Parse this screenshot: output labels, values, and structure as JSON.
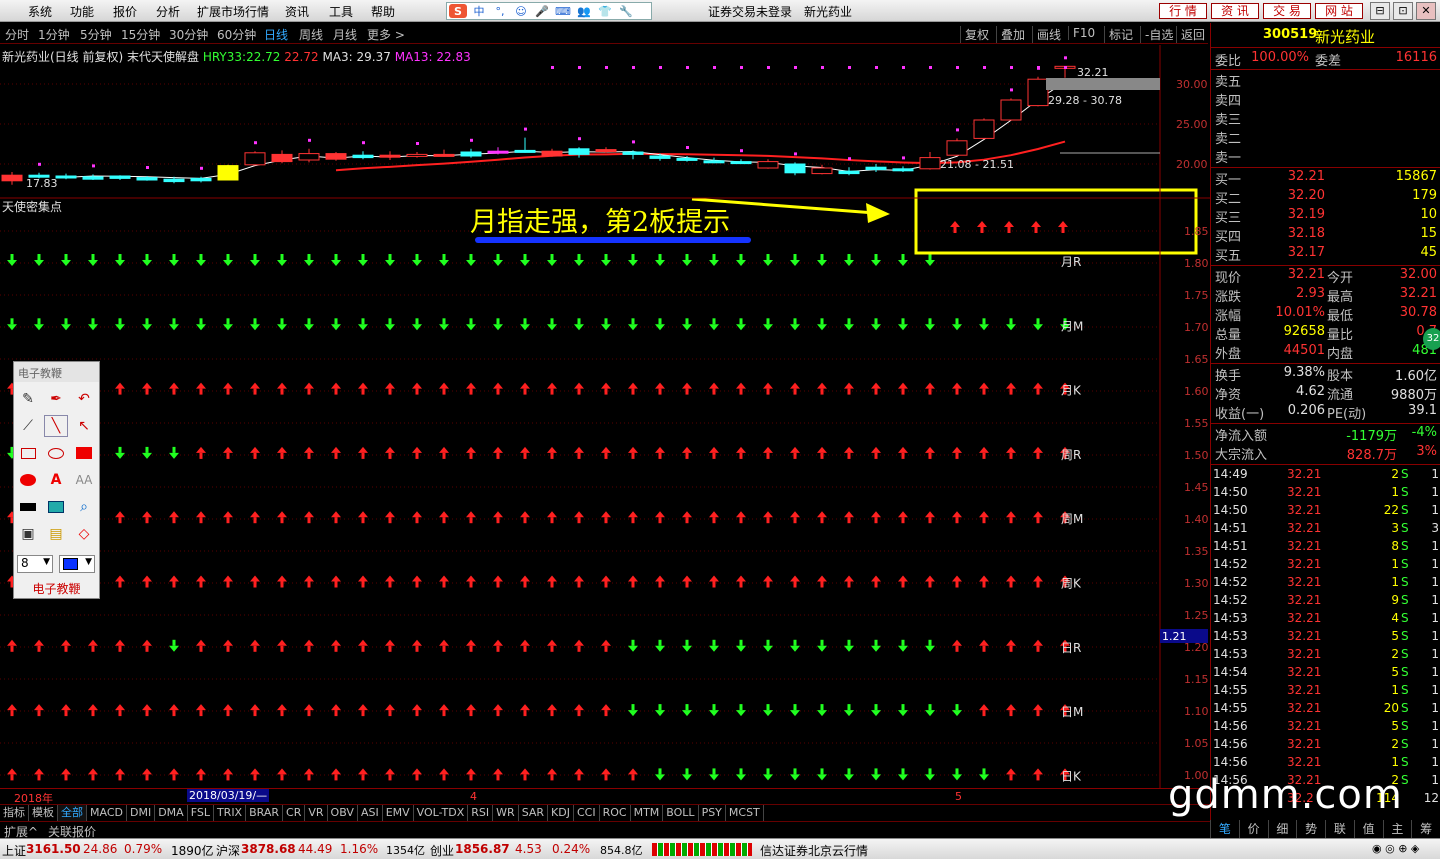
{
  "menu": [
    "系统",
    "功能",
    "报价",
    "分析",
    "扩展市场行情",
    "资讯",
    "工具",
    "帮助"
  ],
  "title": {
    "login": "证券交易未登录",
    "stock": "新光药业"
  },
  "ime_icons": [
    "S",
    "中",
    "°,",
    "☺",
    "🎤",
    "⌨",
    "👥",
    "👕",
    "🔧"
  ],
  "right_tabs": [
    "行 情",
    "资 讯",
    "交 易",
    "网 站"
  ],
  "window_buttons": [
    "⊟",
    "⊡",
    "✕"
  ],
  "periods": [
    "分时",
    "1分钟",
    "5分钟",
    "15分钟",
    "30分钟",
    "60分钟",
    "日线",
    "周线",
    "月线",
    "更多 >"
  ],
  "active_period": "日线",
  "chart_tools": [
    "复权",
    "叠加",
    "画线",
    "F10",
    "标记",
    "-自选",
    "返回"
  ],
  "infoline": {
    "name": "新光药业(日线 前复权) 末代天使解盘",
    "hry_label": "HRY33:",
    "hry_val1": "22.72",
    "hry_val2": "22.72",
    "ma3": "MA3: 29.37",
    "ma13": "MA13: 22.83"
  },
  "price_labels": {
    "high": "32.21",
    "range_upper": "29.28 - 30.78",
    "range_lower": "21.08 - 21.51",
    "low": "17.83"
  },
  "indicator_title": "天使密集点",
  "annotation": "月指走强，第2板提示",
  "upper_axis": [
    "30.00",
    "25.00",
    "20.00"
  ],
  "lower_axis": [
    "1.85",
    "1.80",
    "1.75",
    "1.70",
    "1.65",
    "1.60",
    "1.55",
    "1.50",
    "1.45",
    "1.40",
    "1.35",
    "1.30",
    "1.25",
    "1.20",
    "1.15",
    "1.10",
    "1.05",
    "1.00"
  ],
  "cursor_value": "1.21",
  "signals": [
    {
      "label": "月R",
      "pattern": "GGGGGGGGGGGGGGGGGGGGGGGGGGGGGGGGGGG"
    },
    {
      "label": "月M",
      "pattern": "GGGGGGGGGGGGGGGGGGGGGGGGGGGGGGGGGGGGGGGG"
    },
    {
      "label": "月K",
      "pattern": "RRRRRRRRRRRRRRRRRRRRRRRRRRRRRRRRRRRRRRRR"
    },
    {
      "label": "周R",
      "pattern": "GGGGGGGRRRRRRRRRRRRRRRRRRRRRRRRRRRRRRRRR"
    },
    {
      "label": "周M",
      "pattern": "RRRRRRRRRRRRRRRRRRRRRRRRRRRRRRRRRRRRRRRR"
    },
    {
      "label": "周K",
      "pattern": "RRRRRRRRRRRRRRRRRRRRRRRRRRRRRRRRRRRRRRRR"
    },
    {
      "label": "日R",
      "pattern": "RRRRRRGRRRRRRRRRRRRRRRRGGGGGGGGGGGGRRRRR"
    },
    {
      "label": "日M",
      "pattern": "RRRRRRRRRRRRRRRRRRRRRRRGGGGGGGGGGGGGRRRR"
    },
    {
      "label": "日K",
      "pattern": "RRRRRRRRRRRRRRRRRRRRRRRRGGGGGGGGGGGGGRRR"
    }
  ],
  "extra_signal_row": {
    "pattern": "RRRRR"
  },
  "date_axis": {
    "year": "2018年",
    "cursor_date": "2018/03/19/—",
    "m4": "4",
    "m5": "5"
  },
  "indicators": [
    "指标",
    "模板",
    "全部",
    "MACD",
    "DMI",
    "DMA",
    "FSL",
    "TRIX",
    "BRAR",
    "CR",
    "VR",
    "OBV",
    "ASI",
    "EMV",
    "VOL-TDX",
    "RSI",
    "WR",
    "SAR",
    "KDJ",
    "CCI",
    "ROC",
    "MTM",
    "BOLL",
    "PSY",
    "MCST"
  ],
  "active_indicator": "全部",
  "ext_bar": [
    "扩展^",
    "关联报价"
  ],
  "palette": {
    "title": "电子教鞭",
    "caption": "电子教鞭",
    "size": "8"
  },
  "quote": {
    "code": "300519",
    "name": "新光药业",
    "weibi_label": "委比",
    "weibi": "100.00%",
    "weicha_label": "委差",
    "weicha": "16116",
    "sells": [
      {
        "label": "卖五",
        "price": "",
        "vol": ""
      },
      {
        "label": "卖四",
        "price": "",
        "vol": ""
      },
      {
        "label": "卖三",
        "price": "",
        "vol": ""
      },
      {
        "label": "卖二",
        "price": "",
        "vol": ""
      },
      {
        "label": "卖一",
        "price": "",
        "vol": ""
      }
    ],
    "buys": [
      {
        "label": "买一",
        "price": "32.21",
        "vol": "15867"
      },
      {
        "label": "买二",
        "price": "32.20",
        "vol": "179"
      },
      {
        "label": "买三",
        "price": "32.19",
        "vol": "10"
      },
      {
        "label": "买四",
        "price": "32.18",
        "vol": "15"
      },
      {
        "label": "买五",
        "price": "32.17",
        "vol": "45"
      }
    ],
    "stats": [
      {
        "l1": "现价",
        "v1": "32.21",
        "l2": "今开",
        "v2": "32.00",
        "c1": "red",
        "c2": "red"
      },
      {
        "l1": "涨跌",
        "v1": "2.93",
        "l2": "最高",
        "v2": "32.21",
        "c1": "red",
        "c2": "red"
      },
      {
        "l1": "涨幅",
        "v1": "10.01%",
        "l2": "最低",
        "v2": "30.78",
        "c1": "red",
        "c2": "red"
      },
      {
        "l1": "总量",
        "v1": "92658",
        "l2": "量比",
        "v2": "0.7",
        "c1": "yel",
        "c2": "red"
      },
      {
        "l1": "外盘",
        "v1": "44501",
        "l2": "内盘",
        "v2": "481",
        "c1": "red",
        "c2": "grn"
      }
    ],
    "stats2": [
      {
        "l1": "换手",
        "v1": "9.38%",
        "l2": "股本",
        "v2": "1.60亿"
      },
      {
        "l1": "净资",
        "v1": "4.62",
        "l2": "流通",
        "v2": "9880万"
      },
      {
        "l1": "收益(一)",
        "v1": "0.206",
        "l2": "PE(动)",
        "v2": "39.1"
      }
    ],
    "flows": [
      {
        "l": "净流入额",
        "v": "-1179万",
        "p": "-4%",
        "c": "grn"
      },
      {
        "l": "大宗流入",
        "v": "828.7万",
        "p": "3%",
        "c": "red"
      }
    ],
    "badge": "32"
  },
  "ticks": [
    {
      "t": "14:49",
      "p": "32.21",
      "v": "2",
      "s": "S"
    },
    {
      "t": "14:50",
      "p": "32.21",
      "v": "1",
      "s": "S"
    },
    {
      "t": "14:50",
      "p": "32.21",
      "v": "22",
      "s": "S"
    },
    {
      "t": "14:51",
      "p": "32.21",
      "v": "3",
      "s": "S"
    },
    {
      "t": "14:51",
      "p": "32.21",
      "v": "8",
      "s": "S"
    },
    {
      "t": "14:52",
      "p": "32.21",
      "v": "1",
      "s": "S"
    },
    {
      "t": "14:52",
      "p": "32.21",
      "v": "1",
      "s": "S"
    },
    {
      "t": "14:52",
      "p": "32.21",
      "v": "9",
      "s": "S"
    },
    {
      "t": "14:53",
      "p": "32.21",
      "v": "4",
      "s": "S"
    },
    {
      "t": "14:53",
      "p": "32.21",
      "v": "5",
      "s": "S"
    },
    {
      "t": "14:53",
      "p": "32.21",
      "v": "2",
      "s": "S"
    },
    {
      "t": "14:54",
      "p": "32.21",
      "v": "5",
      "s": "S"
    },
    {
      "t": "14:55",
      "p": "32.21",
      "v": "1",
      "s": "S"
    },
    {
      "t": "14:55",
      "p": "32.21",
      "v": "20",
      "s": "S"
    },
    {
      "t": "14:56",
      "p": "32.21",
      "v": "5",
      "s": "S"
    },
    {
      "t": "14:56",
      "p": "32.21",
      "v": "2",
      "s": "S"
    },
    {
      "t": "14:56",
      "p": "32.21",
      "v": "1",
      "s": "S"
    },
    {
      "t": "14:56",
      "p": "32.21",
      "v": "2",
      "s": "S"
    }
  ],
  "tick_extra": [
    "1",
    "1",
    "1",
    "3",
    "1",
    "1",
    "1",
    "1",
    "1",
    "1",
    "1",
    "1",
    "1",
    "1",
    "1",
    "1",
    "1",
    "1"
  ],
  "tick_last": {
    "p": "32.2",
    "v": "114",
    "x": "12"
  },
  "rtabs": [
    "笔",
    "价",
    "细",
    "势",
    "联",
    "值",
    "主",
    "筹"
  ],
  "status": {
    "sh_label": "上证",
    "sh": "3161.50",
    "sh_chg": "24.86",
    "sh_pct": "0.79%",
    "sh_amt": "1890亿",
    "sz_label": "沪深",
    "sz": "3878.68",
    "sz_chg": "44.49",
    "sz_pct": "1.16%",
    "sz_amt": "1354亿",
    "cy_label": "创业",
    "cy": "1856.87",
    "cy_chg": "4.53",
    "cy_pct": "0.24%",
    "cy_amt": "854.8亿",
    "server": "信达证券北京云行情"
  },
  "watermark": "gdmm.com",
  "candles": [
    {
      "o": 18.6,
      "c": 17.9,
      "h": 19.0,
      "l": 17.4
    },
    {
      "o": 18.4,
      "c": 18.6,
      "h": 18.9,
      "l": 18.2
    },
    {
      "o": 18.3,
      "c": 18.5,
      "h": 18.8,
      "l": 18.1
    },
    {
      "o": 18.1,
      "c": 18.4,
      "h": 18.7,
      "l": 18.0
    },
    {
      "o": 18.2,
      "c": 18.5,
      "h": 18.6,
      "l": 18.0
    },
    {
      "o": 18.0,
      "c": 18.3,
      "h": 18.5,
      "l": 17.9
    },
    {
      "o": 17.8,
      "c": 18.1,
      "h": 18.4,
      "l": 17.6
    },
    {
      "o": 17.9,
      "c": 18.2,
      "h": 18.4,
      "l": 17.7
    },
    {
      "o": 18.0,
      "c": 19.8,
      "h": 19.9,
      "l": 18.0
    },
    {
      "o": 19.9,
      "c": 21.4,
      "h": 21.6,
      "l": 19.8
    },
    {
      "o": 21.2,
      "c": 20.3,
      "h": 21.7,
      "l": 20.1
    },
    {
      "o": 20.5,
      "c": 21.3,
      "h": 21.9,
      "l": 20.2
    },
    {
      "o": 21.3,
      "c": 20.6,
      "h": 21.5,
      "l": 20.4
    },
    {
      "o": 20.8,
      "c": 21.1,
      "h": 21.6,
      "l": 20.6
    },
    {
      "o": 21.1,
      "c": 20.9,
      "h": 21.6,
      "l": 20.5
    },
    {
      "o": 21.0,
      "c": 21.2,
      "h": 21.5,
      "l": 20.8
    },
    {
      "o": 21.2,
      "c": 21.0,
      "h": 21.8,
      "l": 20.9
    },
    {
      "o": 21.0,
      "c": 21.5,
      "h": 21.9,
      "l": 20.8
    },
    {
      "o": 21.4,
      "c": 21.6,
      "h": 22.1,
      "l": 21.2
    },
    {
      "o": 21.6,
      "c": 21.7,
      "h": 23.3,
      "l": 21.4
    },
    {
      "o": 21.6,
      "c": 21.0,
      "h": 21.9,
      "l": 20.9
    },
    {
      "o": 21.2,
      "c": 21.9,
      "h": 22.1,
      "l": 20.8
    },
    {
      "o": 21.8,
      "c": 21.6,
      "h": 22.1,
      "l": 21.4
    },
    {
      "o": 21.5,
      "c": 21.2,
      "h": 21.7,
      "l": 20.6
    },
    {
      "o": 21.0,
      "c": 20.7,
      "h": 21.3,
      "l": 20.4
    },
    {
      "o": 20.7,
      "c": 20.5,
      "h": 21.0,
      "l": 20.3
    },
    {
      "o": 20.4,
      "c": 20.2,
      "h": 20.8,
      "l": 20.1
    },
    {
      "o": 20.3,
      "c": 20.1,
      "h": 20.6,
      "l": 20.0
    },
    {
      "o": 19.5,
      "c": 20.3,
      "h": 20.6,
      "l": 19.4
    },
    {
      "o": 20.0,
      "c": 18.9,
      "h": 20.2,
      "l": 18.6
    },
    {
      "o": 18.8,
      "c": 19.5,
      "h": 19.9,
      "l": 18.7
    },
    {
      "o": 19.1,
      "c": 18.8,
      "h": 19.6,
      "l": 18.6
    },
    {
      "o": 19.3,
      "c": 19.6,
      "h": 20.0,
      "l": 19.0
    },
    {
      "o": 19.4,
      "c": 19.2,
      "h": 19.7,
      "l": 19.0
    },
    {
      "o": 19.4,
      "c": 20.8,
      "h": 21.5,
      "l": 19.3
    },
    {
      "o": 21.1,
      "c": 22.9,
      "h": 23.2,
      "l": 21.0
    },
    {
      "o": 23.2,
      "c": 25.5,
      "h": 25.7,
      "l": 23.1
    },
    {
      "o": 25.5,
      "c": 28.0,
      "h": 28.2,
      "l": 25.4
    },
    {
      "o": 27.3,
      "c": 30.6,
      "h": 30.9,
      "l": 27.2
    },
    {
      "o": 32.0,
      "c": 32.21,
      "h": 32.21,
      "l": 30.78
    }
  ],
  "candle_colors": "RCCCCCCCYRRRRCRRRCMCRCRCCCCCRCRCCCRRRRRR"
}
